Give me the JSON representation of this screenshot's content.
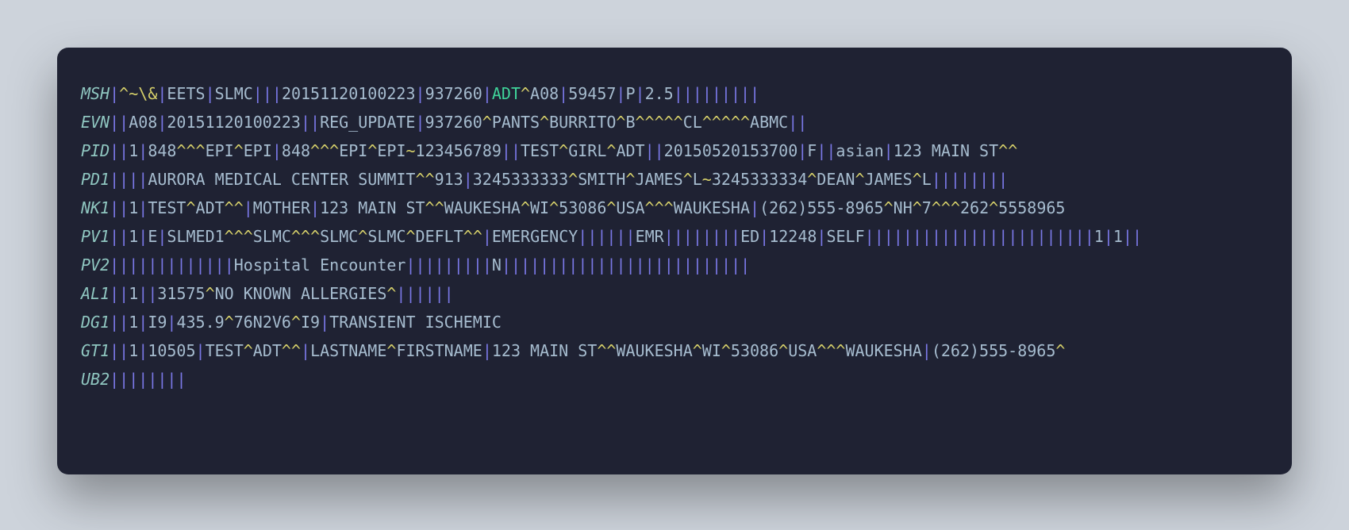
{
  "colors": {
    "page_bg": "#cdd3db",
    "card_bg": "#1f2233",
    "segment_id": "#8fc6c0",
    "pipe": "#7a78e6",
    "caret": "#d6d06a",
    "text": "#a6bccf",
    "highlight": "#3fd49a"
  },
  "highlight_token": "ADT",
  "lines": [
    {
      "id": "MSH",
      "body": "^~\\&|EETS|SLMC|||20151120100223|937260|ADT^A08|59457|P|2.5|||||||||"
    },
    {
      "id": "EVN",
      "body": "|A08|20151120100223||REG_UPDATE|937260^PANTS^BURRITO^B^^^^^CL^^^^^ABMC||"
    },
    {
      "id": "PID",
      "body": "|1|848^^^EPI^EPI|848^^^EPI^EPI~123456789||TEST^GIRL^ADT||20150520153700|F||asian|123 MAIN ST^^"
    },
    {
      "id": "PD1",
      "body": "|||AURORA MEDICAL CENTER SUMMIT^^913|3245333333^SMITH^JAMES^L~3245333334^DEAN^JAMES^L||||||||"
    },
    {
      "id": "NK1",
      "body": "|1|TEST^ADT^^|MOTHER|123 MAIN ST^^WAUKESHA^WI^53086^USA^^^WAUKESHA|(262)555-8965^NH^7^^^262^5558965"
    },
    {
      "id": "PV1",
      "body": "|1|E|SLMED1^^^SLMC^^^SLMC^SLMC^DEFLT^^|EMERGENCY||||||EMR||||||||ED|12248|SELF||||||||||||||||||||||||1|1||"
    },
    {
      "id": "PV2",
      "body": "||||||||||||Hospital Encounter|||||||||N||||||||||||||||||||||||||"
    },
    {
      "id": "AL1",
      "body": "|1||31575^NO KNOWN ALLERGIES^||||||"
    },
    {
      "id": "DG1",
      "body": "|1|I9|435.9^76N2V6^I9|TRANSIENT ISCHEMIC"
    },
    {
      "id": "GT1",
      "body": "|1|10505|TEST^ADT^^|LASTNAME^FIRSTNAME|123 MAIN ST^^WAUKESHA^WI^53086^USA^^^WAUKESHA|(262)555-8965^"
    },
    {
      "id": "UB2",
      "body": "|||||||"
    }
  ]
}
